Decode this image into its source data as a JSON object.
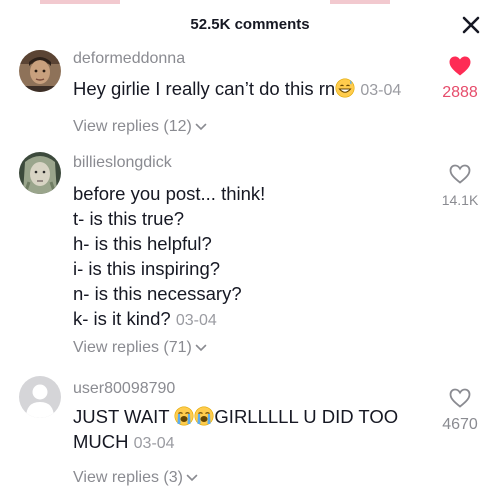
{
  "header": {
    "title": "52.5K comments",
    "close_icon": "close-icon"
  },
  "colors": {
    "liked": "#fe2c55",
    "muted_text": "#8a8b91",
    "body_text": "#161823",
    "top_strip": "#f2c9cf"
  },
  "comments": [
    {
      "username": "deformeddonna",
      "text": "Hey girlie I really can’t do this rn",
      "emoji": "grinning-sweat-emoji",
      "date": "03-04",
      "likes": "2888",
      "liked": true,
      "view_replies": "View replies (12)"
    },
    {
      "username": "billieslongdick",
      "lines": [
        "before you post... think!",
        "t- is this true?",
        "h- is this helpful?",
        "i- is this inspiring?",
        "n- is this necessary?",
        "k- is it kind?"
      ],
      "date": "03-04",
      "likes": "14.1K",
      "liked": false,
      "view_replies": "View replies (71)"
    },
    {
      "username": "user80098790",
      "text_before": "JUST WAIT",
      "emojis": [
        "loudly-crying-emoji",
        "loudly-crying-emoji"
      ],
      "text_after": "GIRLLLLL U DID TOO MUCH",
      "date": "03-04",
      "likes": "4670",
      "liked": false,
      "view_replies": "View replies (3)"
    }
  ]
}
